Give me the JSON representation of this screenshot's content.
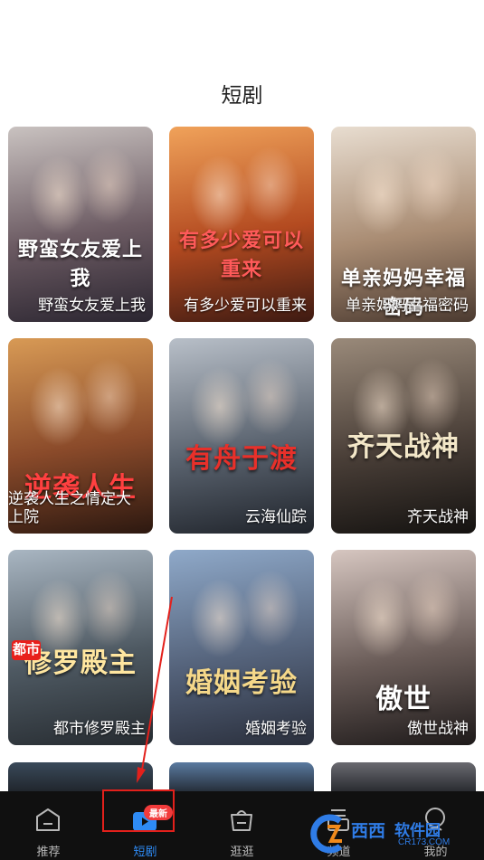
{
  "header": {
    "title": "短剧"
  },
  "dramas": [
    {
      "caption": "野蛮女友爱上我",
      "art_title": "野蛮女友爱上我",
      "colors": [
        "#c9c2c0",
        "#6b5a62",
        "#2a2530"
      ]
    },
    {
      "caption": "有多少爱可以重来",
      "art_title": "有多少爱可以重来",
      "colors": [
        "#f0a25a",
        "#b34a20",
        "#3d1a12"
      ]
    },
    {
      "caption": "单亲妈妈幸福密码",
      "art_title": "单亲妈妈幸福密码",
      "colors": [
        "#e8ddd0",
        "#a98c73",
        "#4b3a30"
      ]
    },
    {
      "caption": "逆袭人生之情定大",
      "caption_line2": "上院",
      "art_title": "逆袭人生",
      "colors": [
        "#d89a55",
        "#8a4a2a",
        "#2c1810"
      ]
    },
    {
      "caption": "云海仙踪",
      "art_title": "有舟于渡",
      "colors": [
        "#b8bfc8",
        "#5b6470",
        "#1f232a"
      ]
    },
    {
      "caption": "齐天战神",
      "art_title": "齐天战神",
      "colors": [
        "#9a8a7a",
        "#4a3f38",
        "#141210"
      ]
    },
    {
      "caption": "都市修罗殿主",
      "art_title": "修罗殿主",
      "badge": "都市",
      "colors": [
        "#a9b6c2",
        "#4e5962",
        "#262b30"
      ]
    },
    {
      "caption": "婚姻考验",
      "art_title": "婚姻考验",
      "colors": [
        "#8fa9c9",
        "#54627a",
        "#2a2f3c"
      ]
    },
    {
      "caption": "傲世战神",
      "art_title": "傲世",
      "colors": [
        "#d6c6c0",
        "#6a5c58",
        "#1e1a1a"
      ]
    }
  ],
  "peek_colors": [
    "#3a4a5a",
    "#5a7aa0",
    "#6a6a70"
  ],
  "tabbar": {
    "tabs": [
      {
        "label": "推荐",
        "icon": "home-icon"
      },
      {
        "label": "短剧",
        "icon": "drama-icon",
        "badge": "最新",
        "active": true
      },
      {
        "label": "逛逛",
        "icon": "bag-icon"
      },
      {
        "label": "频道",
        "icon": "channel-icon"
      },
      {
        "label": "我的",
        "icon": "profile-icon"
      }
    ],
    "active_color": "#2e8bf5",
    "inactive_color": "#b7b7b7"
  },
  "watermark": {
    "text1": "西西",
    "text2": "软件园",
    "text3": "CR173.COM"
  }
}
